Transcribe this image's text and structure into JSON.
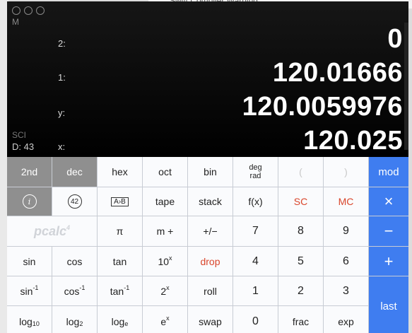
{
  "window": {
    "memory_flag": "M",
    "mode": "SCI",
    "digits": "D: 43"
  },
  "background": {
    "title_fragment": "Swift Compiler Warning"
  },
  "stack": [
    {
      "label": "2:",
      "value": "0"
    },
    {
      "label": "1:",
      "value": "120.01666"
    },
    {
      "label": "y:",
      "value": "120.0059976"
    },
    {
      "label": "x:",
      "value": "120.025"
    }
  ],
  "keys": {
    "r1": [
      "2nd",
      "dec",
      "hex",
      "oct",
      "bin",
      "deg",
      "rad",
      "(",
      ")",
      "mod"
    ],
    "r2": [
      "i",
      "42",
      "A›B",
      "tape",
      "stack",
      "f(x)",
      "SC",
      "MC",
      "×"
    ],
    "r3": [
      "pcalc",
      "4",
      "π",
      "m +",
      "+/−",
      "7",
      "8",
      "9",
      "−"
    ],
    "r4": [
      "sin",
      "cos",
      "tan",
      "10",
      "x",
      "drop",
      "4",
      "5",
      "6",
      "+"
    ],
    "r5": [
      "sin",
      "-1",
      "cos",
      "-1",
      "tan",
      "-1",
      "2",
      "x",
      "roll",
      "1",
      "2",
      "3",
      "last"
    ],
    "r6": [
      "log",
      "10",
      "log",
      "2",
      "log",
      "e",
      "e",
      "x",
      "swap",
      "0",
      "frac",
      "exp"
    ]
  },
  "colors": {
    "accent": "#3f7df0",
    "danger": "#d9452b",
    "display_bg": "#000000"
  }
}
